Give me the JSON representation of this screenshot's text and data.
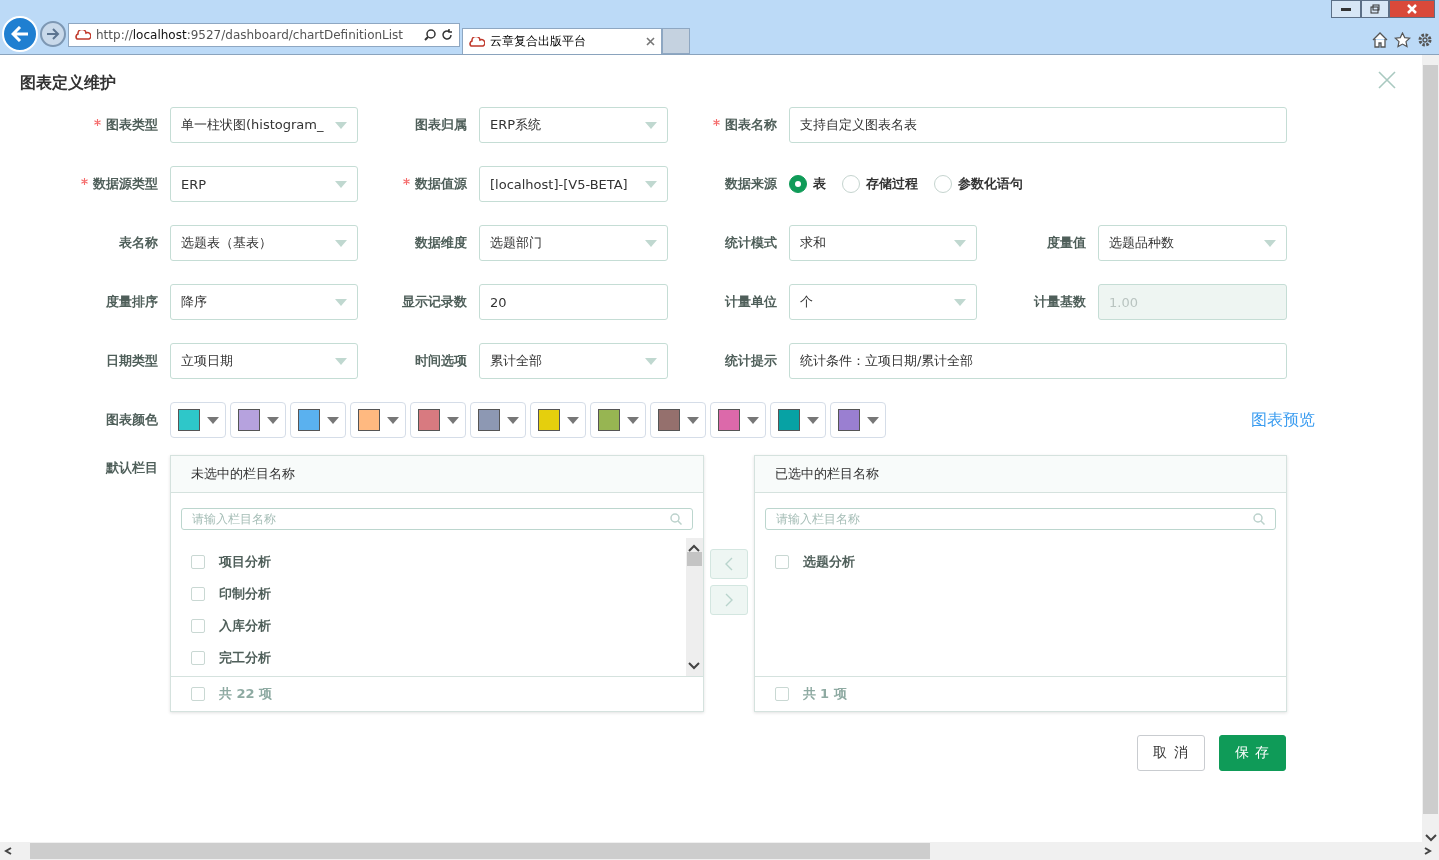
{
  "browser": {
    "url_prefix": "http://",
    "url_host": "localhost",
    "url_rest": ":9527/dashboard/chartDefinitionList",
    "tab_title": "云章复合出版平台"
  },
  "dialog": {
    "title": "图表定义维护"
  },
  "form_rows": [
    [
      {
        "kind": "select",
        "label": "图表类型",
        "required": true,
        "value": "单一柱状图(histogram_"
      },
      {
        "kind": "select",
        "label": "图表归属",
        "required": false,
        "value": "ERP系统"
      },
      {
        "kind": "wide",
        "label": "图表名称",
        "required": true,
        "value": "支持自定义图表名表"
      }
    ],
    [
      {
        "kind": "select",
        "label": "数据源类型",
        "required": true,
        "value": "ERP"
      },
      {
        "kind": "select",
        "label": "数据值源",
        "required": true,
        "value": "[localhost]-[V5-BETA]"
      },
      {
        "kind": "radio",
        "label": "数据来源",
        "required": false,
        "options": [
          {
            "label": "表",
            "selected": true
          },
          {
            "label": "存储过程",
            "selected": false
          },
          {
            "label": "参数化语句",
            "selected": false
          }
        ]
      }
    ],
    [
      {
        "kind": "select",
        "label": "表名称",
        "required": false,
        "value": "选题表（基表）"
      },
      {
        "kind": "select",
        "label": "数据维度",
        "required": false,
        "value": "选题部门"
      },
      {
        "kind": "select",
        "label": "统计模式",
        "required": false,
        "value": "求和"
      },
      {
        "kind": "select",
        "label": "度量值",
        "required": false,
        "value": "选题品种数"
      }
    ],
    [
      {
        "kind": "select",
        "label": "度量排序",
        "required": false,
        "value": "降序"
      },
      {
        "kind": "input",
        "label": "显示记录数",
        "required": false,
        "value": "20",
        "disabled": false
      },
      {
        "kind": "select",
        "label": "计量单位",
        "required": false,
        "value": "个"
      },
      {
        "kind": "input",
        "label": "计量基数",
        "required": false,
        "value": "1.00",
        "disabled": true
      }
    ],
    [
      {
        "kind": "select",
        "label": "日期类型",
        "required": false,
        "value": "立项日期"
      },
      {
        "kind": "select",
        "label": "时间选项",
        "required": false,
        "value": "累计全部"
      },
      {
        "kind": "wide",
        "label": "统计提示",
        "required": false,
        "value": "统计条件：立项日期/累计全部"
      }
    ]
  ],
  "colors": {
    "label": "图表颜色",
    "swatches": [
      {
        "color": "#2ec7c9"
      },
      {
        "color": "#b6a2de"
      },
      {
        "color": "#5ab1ef"
      },
      {
        "color": "#ffb980"
      },
      {
        "color": "#d87a80"
      },
      {
        "color": "#8d98b3"
      },
      {
        "color": "#e5cf0d"
      },
      {
        "color": "#97b552"
      },
      {
        "color": "#95706d"
      },
      {
        "color": "#dc69aa"
      },
      {
        "color": "#07a2a4"
      },
      {
        "color": "#9a7fd1"
      }
    ],
    "preview_link": "图表预览"
  },
  "columns": {
    "label": "默认栏目",
    "left": {
      "title": "未选中的栏目名称",
      "placeholder": "请输入栏目名称",
      "items": [
        {
          "label": "项目分析",
          "checked": false
        },
        {
          "label": "印制分析",
          "checked": false
        },
        {
          "label": "入库分析",
          "checked": false
        },
        {
          "label": "完工分析",
          "checked": false
        }
      ],
      "footer": "共 22 项",
      "footer_checked": false
    },
    "right": {
      "title": "已选中的栏目名称",
      "placeholder": "请输入栏目名称",
      "items": [
        {
          "label": "选题分析",
          "checked": false
        }
      ],
      "footer": "共 1 项",
      "footer_checked": false
    }
  },
  "buttons": {
    "cancel": "取 消",
    "save": "保 存"
  }
}
